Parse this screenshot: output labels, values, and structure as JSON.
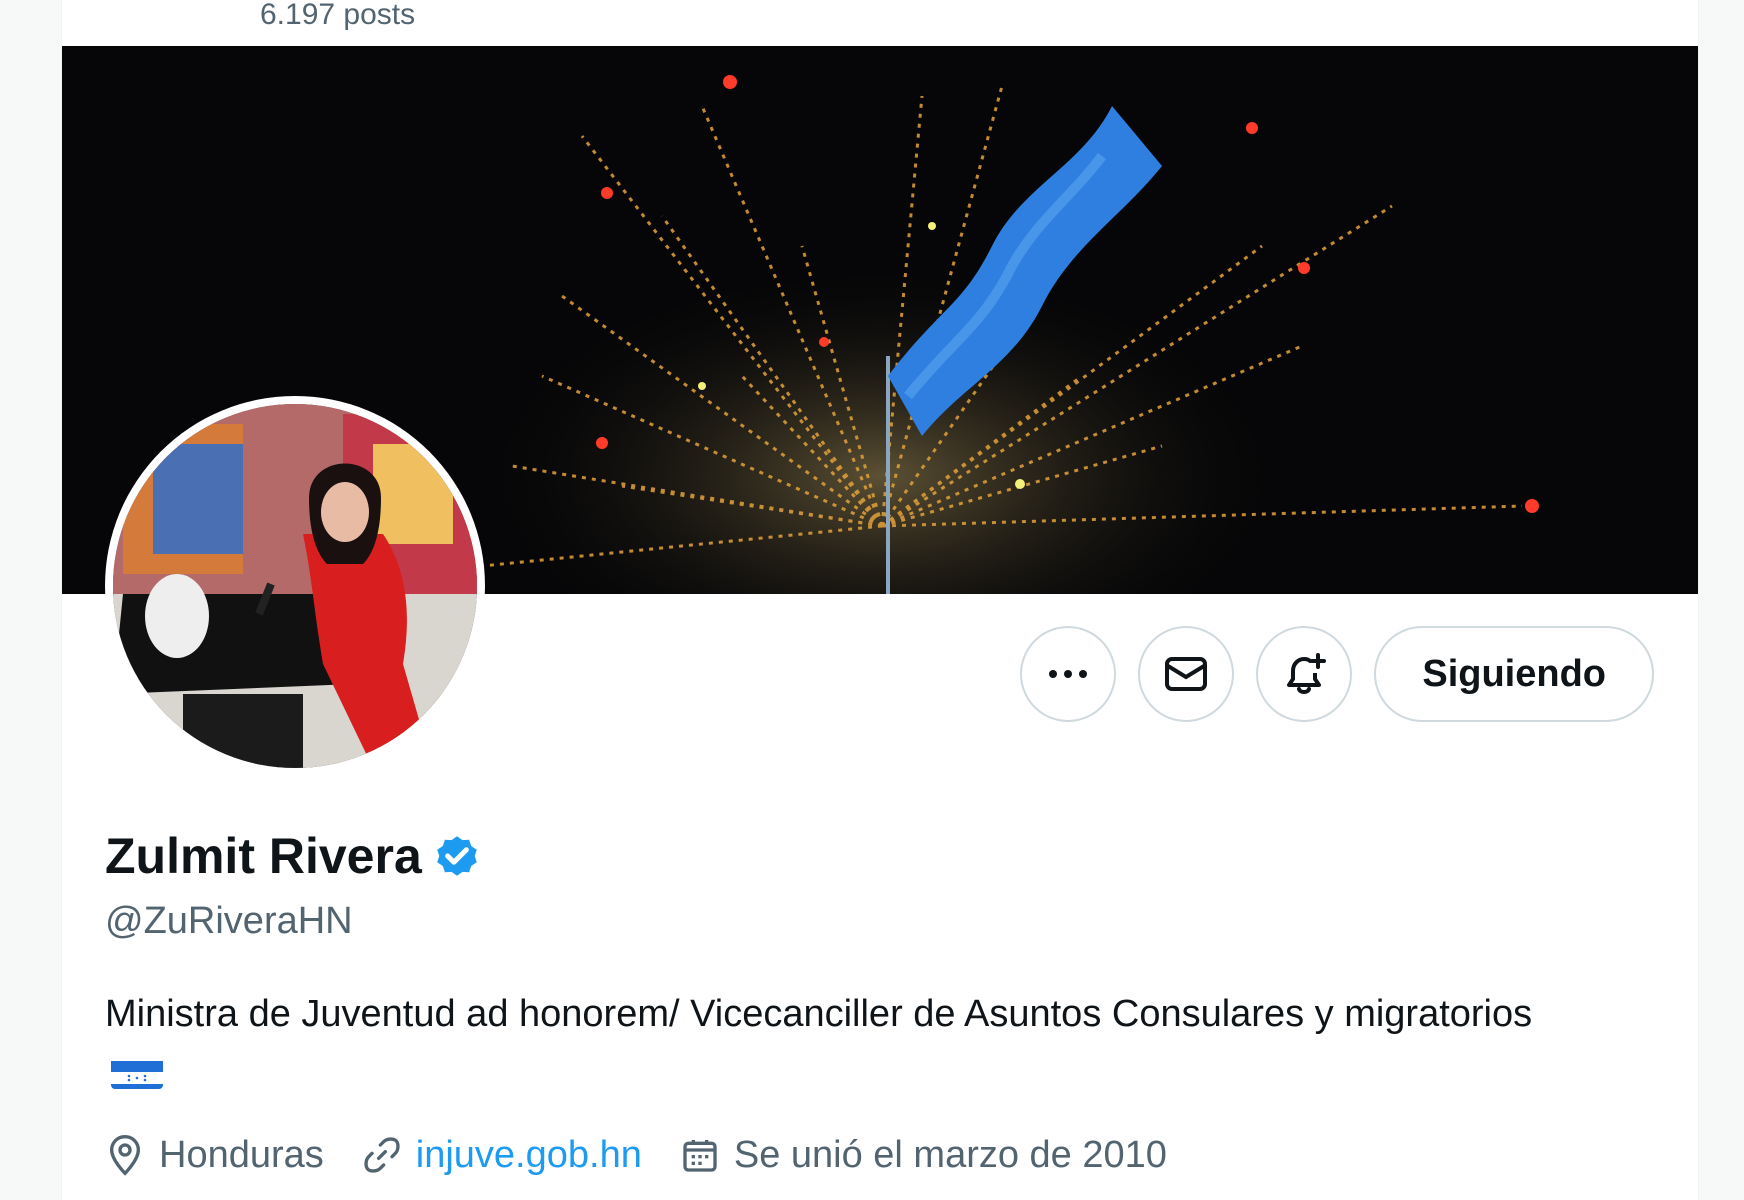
{
  "header": {
    "posts_count": "6.197 posts"
  },
  "profile": {
    "display_name": "Zulmit Rivera",
    "handle": "@ZuRiveraHN",
    "verified": true,
    "bio": "Ministra de Juventud ad honorem/ Vicecanciller de Asuntos Consulares y migratorios",
    "bio_emoji": "honduras-flag",
    "location": "Honduras",
    "website": "injuve.gob.hn",
    "joined": "Se unió el marzo de 2010"
  },
  "actions": {
    "more_icon": "more-horizontal-icon",
    "message_icon": "envelope-icon",
    "notify_icon": "bell-plus-icon",
    "follow_label": "Siguiendo"
  },
  "colors": {
    "accent": "#1d9bf0",
    "text_primary": "#0f1419",
    "text_secondary": "#536471",
    "border": "#cfd9de"
  }
}
